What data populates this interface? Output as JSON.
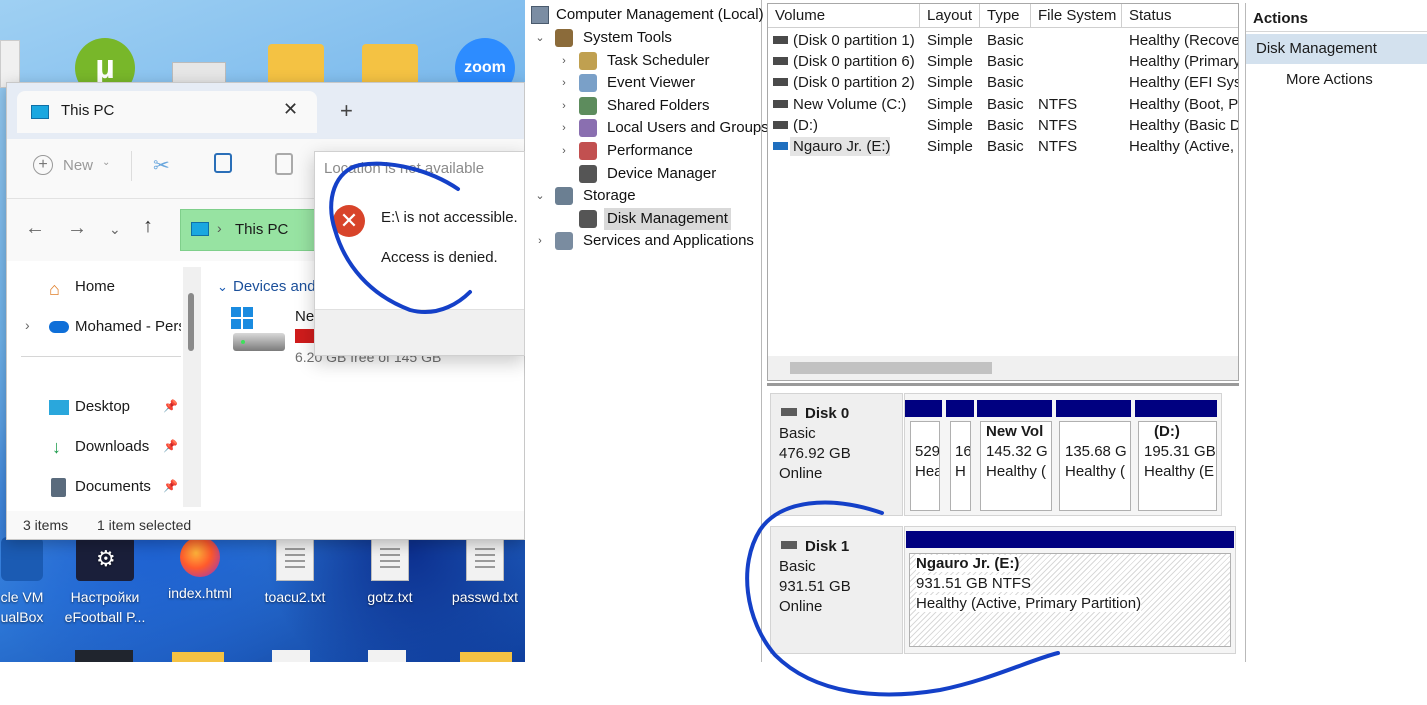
{
  "desktop": {
    "icons": [
      {
        "label": "cle VM\nualBox",
        "kind": "virtualbox"
      },
      {
        "label": "Настройки eFootball P...",
        "kind": "efootball"
      },
      {
        "label": "index.html",
        "kind": "firefox"
      },
      {
        "label": "toacu2.txt",
        "kind": "txt"
      },
      {
        "label": "gotz.txt",
        "kind": "txt"
      },
      {
        "label": "passwd.txt",
        "kind": "txt"
      }
    ],
    "top_icons": [
      {
        "name": "utorrent-icon",
        "color": "#78b72a"
      },
      {
        "name": "zoom-icon",
        "color": "#2d8cff",
        "label": "zoom"
      }
    ]
  },
  "explorer": {
    "tab_title": "This PC",
    "new_label": "New",
    "address": "This PC",
    "nav": {
      "home": "Home",
      "onedrive": "Mohamed - Pers",
      "desktop": "Desktop",
      "downloads": "Downloads",
      "documents": "Documents"
    },
    "section": "Devices and",
    "drive_name": "Ne",
    "drive_free": "6.20 GB free of 145 GB",
    "status_items": "3 items",
    "status_selected": "1 item selected"
  },
  "popup": {
    "title": "Location is not available",
    "message": "E:\\ is not accessible.",
    "detail": "Access is denied."
  },
  "tree": {
    "root": "Computer Management (Local)",
    "items": [
      {
        "label": "System Tools",
        "level": 1,
        "toggle": "⌄"
      },
      {
        "label": "Task Scheduler",
        "level": 2,
        "toggle": "›"
      },
      {
        "label": "Event Viewer",
        "level": 2,
        "toggle": "›"
      },
      {
        "label": "Shared Folders",
        "level": 2,
        "toggle": "›"
      },
      {
        "label": "Local Users and Groups",
        "level": 2,
        "toggle": "›"
      },
      {
        "label": "Performance",
        "level": 2,
        "toggle": "›"
      },
      {
        "label": "Device Manager",
        "level": 2,
        "toggle": ""
      },
      {
        "label": "Storage",
        "level": 1,
        "toggle": "⌄"
      },
      {
        "label": "Disk Management",
        "level": 2,
        "toggle": "",
        "selected": true
      },
      {
        "label": "Services and Applications",
        "level": 1,
        "toggle": "›"
      }
    ]
  },
  "volumes": {
    "headers": [
      "Volume",
      "Layout",
      "Type",
      "File System",
      "Status"
    ],
    "rows": [
      [
        "(Disk 0 partition 1)",
        "Simple",
        "Basic",
        "",
        "Healthy (Recove"
      ],
      [
        "(Disk 0 partition 6)",
        "Simple",
        "Basic",
        "",
        "Healthy (Primary"
      ],
      [
        "(Disk 0 partition 2)",
        "Simple",
        "Basic",
        "",
        "Healthy (EFI Syst"
      ],
      [
        "New Volume (C:)",
        "Simple",
        "Basic",
        "NTFS",
        "Healthy (Boot, Pa"
      ],
      [
        " (D:)",
        "Simple",
        "Basic",
        "NTFS",
        "Healthy (Basic D"
      ],
      [
        "Ngauro Jr. (E:)",
        "Simple",
        "Basic",
        "NTFS",
        "Healthy (Active,"
      ]
    ]
  },
  "disks": [
    {
      "name": "Disk 0",
      "type": "Basic",
      "size": "476.92 GB",
      "status": "Online",
      "partitions": [
        {
          "title": "",
          "size": "529",
          "health": "Hea"
        },
        {
          "title": "",
          "size": "16",
          "health": "H"
        },
        {
          "title": "New Vol",
          "size": "145.32 G",
          "health": "Healthy ("
        },
        {
          "title": "",
          "size": "135.68 G",
          "health": "Healthy ("
        },
        {
          "title": "(D:)",
          "size": "195.31 GB",
          "health": "Healthy (E"
        }
      ]
    },
    {
      "name": "Disk 1",
      "type": "Basic",
      "size": "931.51 GB",
      "status": "Online",
      "partition": {
        "title": "Ngauro Jr.  (E:)",
        "size": "931.51 GB NTFS",
        "health": "Healthy (Active, Primary Partition)"
      }
    }
  ],
  "actions": {
    "header": "Actions",
    "section": "Disk Management",
    "more": "More Actions"
  },
  "colors": {
    "partition_header": "#000080",
    "selection": "#d3e1ee",
    "annotation": "#1440c8",
    "error": "#d8442a"
  }
}
